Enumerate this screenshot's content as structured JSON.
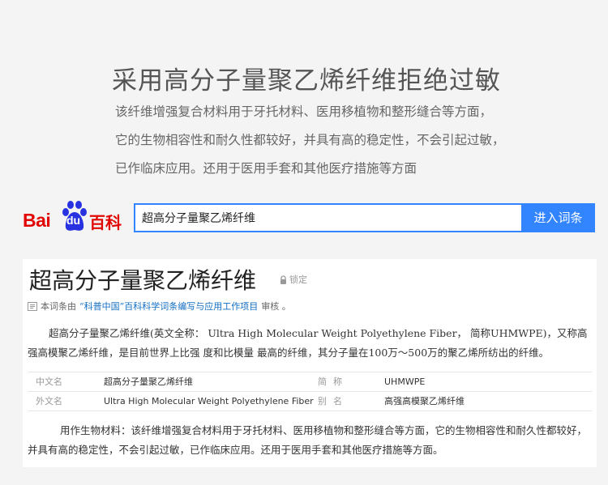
{
  "hero": {
    "title": "采用高分子量聚乙烯纤维拒绝过敏",
    "lines": [
      "该纤维增强复合材料用于牙托材料、医用移植物和整形缝合等方面，",
      "它的生物相容性和耐久性都较好，并具有高的稳定性，不会引起过敏，",
      "已作临床应用。还用于医用手套和其他医疗措施等方面"
    ]
  },
  "logo": {
    "bai": "Bai",
    "du": "du",
    "baike": "百科"
  },
  "search": {
    "value": "超高分子量聚乙烯纤维",
    "button_label": "进入词条"
  },
  "entry": {
    "title": "超高分子量聚乙烯纤维",
    "lock_label": "锁定",
    "review_prefix": "本词条由",
    "review_link": "“科普中国”百科科学词条编写与应用工作项目",
    "review_suffix": "审核 。",
    "intro": "超高分子量聚乙烯纤维(英文全称： Ultra High Molecular Weight Polyethylene Fiber， 简称UHMWPE)，又称高强高模聚乙烯纤维，是目前世界上比强 度和比模量 最高的纤维，其分子量在100万～500万的聚乙烯所纺出的纤维。",
    "info": [
      {
        "k1": "中文名",
        "v1": "超高分子量聚乙烯纤维",
        "k2": "简称",
        "v2": "UHMWPE"
      },
      {
        "k1": "外文名",
        "v1": "Ultra High Molecular Weight Polyethylene Fiber",
        "k2": "别名",
        "v2": "高强高模聚乙烯纤维"
      }
    ],
    "usage": "用作生物材料：该纤维增强复合材料用于牙托材料、医用移植物和整形缝合等方面，它的生物相容性和耐久性都较好，并具有高的稳定性，不会引起过敏，已作临床应用。还用于医用手套和其他医疗措施等方面。"
  },
  "colors": {
    "brand_red": "#e10602",
    "brand_blue": "#2932e1",
    "button_blue": "#3385ff",
    "link_blue": "#136ec2"
  },
  "icons": [
    "baidu-paw-icon",
    "lock-icon",
    "review-icon"
  ]
}
